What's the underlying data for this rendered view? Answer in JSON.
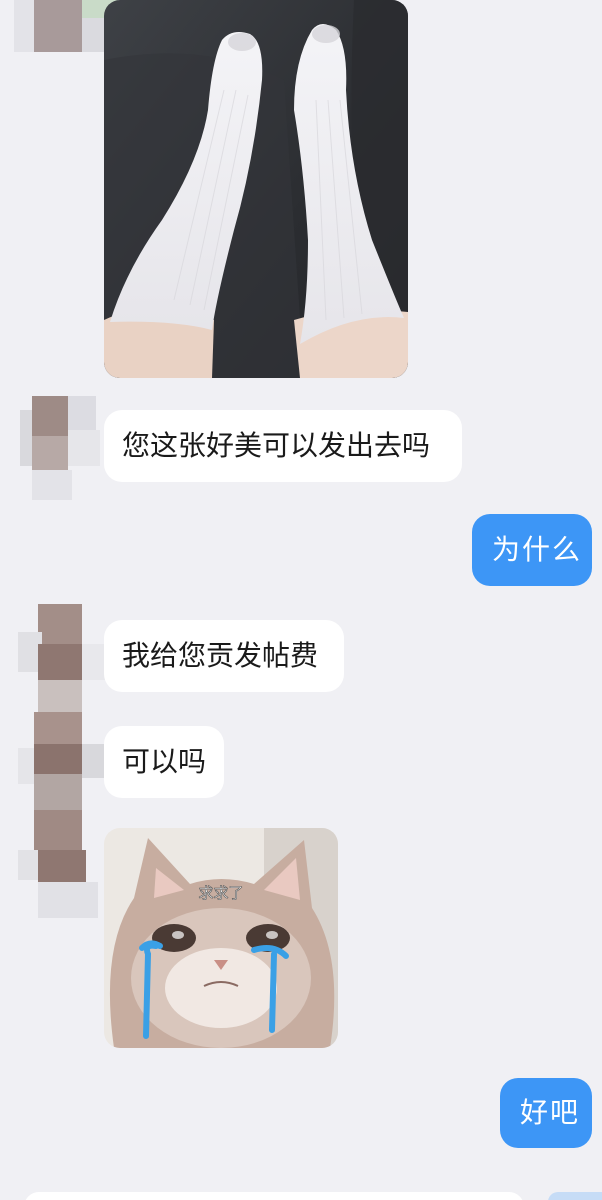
{
  "messages": [
    {
      "side": "incoming",
      "type": "image",
      "image_desc": "legs-white-socks-photo"
    },
    {
      "side": "incoming",
      "type": "text",
      "text": "您这张好美可以发出去吗"
    },
    {
      "side": "outgoing",
      "type": "text",
      "text": "为什么"
    },
    {
      "side": "incoming",
      "type": "text",
      "text": "我给您贡发帖费"
    },
    {
      "side": "incoming",
      "type": "text",
      "text": "可以吗"
    },
    {
      "side": "incoming",
      "type": "sticker",
      "caption": "求求了"
    },
    {
      "side": "outgoing",
      "type": "text",
      "text": "好吧"
    }
  ],
  "colors": {
    "background": "#f0f0f4",
    "incoming_bubble": "#ffffff",
    "outgoing_bubble": "#3d96f6",
    "outgoing_text": "#ffffff",
    "tear": "#3aa0e6"
  },
  "icons": {
    "avatar": "pixelated-avatar"
  }
}
